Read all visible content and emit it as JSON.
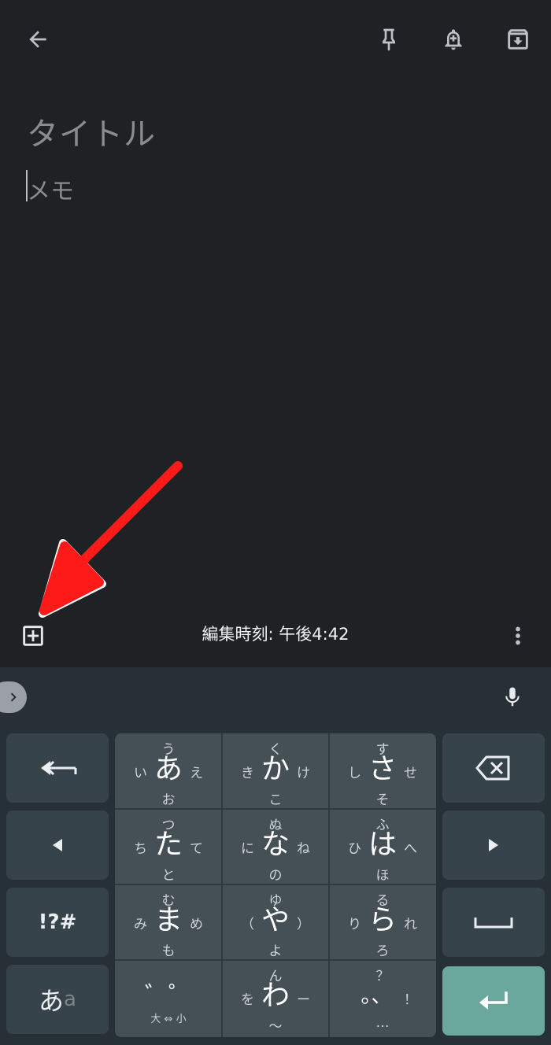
{
  "note": {
    "title_placeholder": "タイトル",
    "memo_placeholder": "メモ",
    "edited_time": "編集時刻: 午後4:42"
  },
  "toolbar": {
    "icons": [
      "back-arrow-icon",
      "pin-icon",
      "reminder-bell-icon",
      "archive-icon"
    ]
  },
  "bottom_bar": {
    "icons": [
      "add-box-icon",
      "more-vert-icon"
    ]
  },
  "keyboard": {
    "grid": [
      {
        "main": "あ",
        "up": "う",
        "down": "お",
        "left": "い",
        "right": "え"
      },
      {
        "main": "か",
        "up": "く",
        "down": "こ",
        "left": "き",
        "right": "け"
      },
      {
        "main": "さ",
        "up": "す",
        "down": "そ",
        "left": "し",
        "right": "せ"
      },
      {
        "main": "た",
        "up": "つ",
        "down": "と",
        "left": "ち",
        "right": "て"
      },
      {
        "main": "な",
        "up": "ぬ",
        "down": "の",
        "left": "に",
        "right": "ね"
      },
      {
        "main": "は",
        "up": "ふ",
        "down": "ほ",
        "left": "ひ",
        "right": "へ"
      },
      {
        "main": "ま",
        "up": "む",
        "down": "も",
        "left": "み",
        "right": "め"
      },
      {
        "main": "や",
        "up": "ゆ",
        "down": "よ",
        "left": "（",
        "right": "）"
      },
      {
        "main": "ら",
        "up": "る",
        "down": "ろ",
        "left": "り",
        "right": "れ"
      },
      {
        "main": "゛゜",
        "up": "",
        "down": "大 ⇔ 小",
        "left": "",
        "right": ""
      },
      {
        "main": "わ",
        "up": "ん",
        "down": "～",
        "left": "を",
        "right": "ー"
      },
      {
        "main": "。、",
        "up": "？",
        "down": "…",
        "left": "",
        "right": "！"
      }
    ],
    "symbols_label": "!?#",
    "mode_label_main": "あ",
    "mode_label_sub": "a"
  },
  "colors": {
    "background": "#202124",
    "keyboard_bg": "#263036",
    "enter_key": "#6aa89e",
    "annotation_arrow": "#ff1a1a"
  }
}
